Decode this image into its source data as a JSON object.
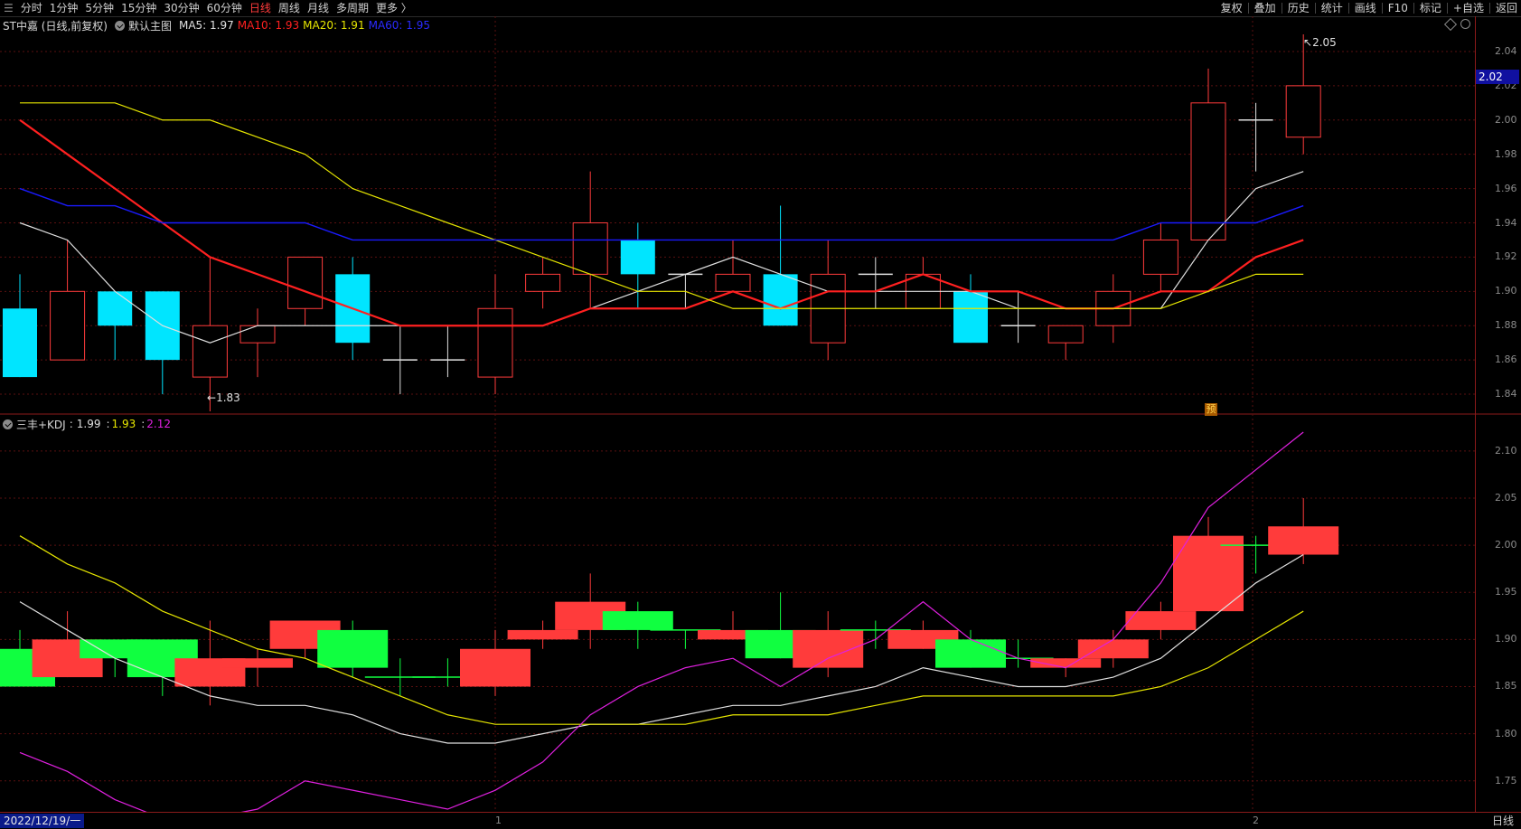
{
  "toolbar": {
    "menu_glyph": "☰",
    "left_items": [
      "分时",
      "1分钟",
      "5分钟",
      "15分钟",
      "30分钟",
      "60分钟",
      "日线",
      "周线",
      "月线",
      "多周期",
      "更多 〉"
    ],
    "active_item": "日线",
    "right_items": [
      "复权",
      "叠加",
      "历史",
      "统计",
      "画线",
      "F10",
      "标记",
      "+自选",
      "返回"
    ]
  },
  "main_panel": {
    "title": "ST中嘉 (日线,前复权)",
    "template_label": "默认主图",
    "ma5_label": "MA5: 1.97",
    "ma10_label": "MA10: 1.93",
    "ma20_label": "MA20: 1.91",
    "ma60_label": "MA60: 1.95",
    "high_marker": "2.05",
    "low_marker": "1.83",
    "current_price_tag": "2.02",
    "yu_badge": "预",
    "y_ticks": [
      "2.04",
      "2.02",
      "2.00",
      "1.98",
      "1.96",
      "1.94",
      "1.92",
      "1.90",
      "1.88",
      "1.86",
      "1.84"
    ]
  },
  "sub_panel": {
    "title": "三丰+KDJ",
    "k_value": "1.99",
    "d_value": "1.93",
    "j_value": "2.12",
    "y_ticks": [
      "2.10",
      "2.05",
      "2.00",
      "1.95",
      "1.90",
      "1.85",
      "1.80",
      "1.75"
    ]
  },
  "bottom": {
    "date": "2022/12/19/一",
    "x_marks": [
      "1",
      "2"
    ],
    "period": "日线"
  },
  "colors": {
    "up": "#ff3b3b",
    "down_main": "#00e5ff",
    "down_sub": "#10ff40",
    "ma5": "#e0e0e0",
    "ma10": "#ff2020",
    "ma20": "#e6e600",
    "ma60": "#1a1aff",
    "j_line": "#e020e0",
    "grid": "#5a1010"
  },
  "chart_data": [
    {
      "type": "candlestick",
      "title": "ST中嘉 (日线,前复权)",
      "ylim": [
        1.83,
        2.05
      ],
      "candles": [
        {
          "o": 1.89,
          "h": 1.91,
          "l": 1.85,
          "c": 1.85
        },
        {
          "o": 1.86,
          "h": 1.93,
          "l": 1.86,
          "c": 1.9
        },
        {
          "o": 1.9,
          "h": 1.9,
          "l": 1.86,
          "c": 1.88
        },
        {
          "o": 1.9,
          "h": 1.9,
          "l": 1.84,
          "c": 1.86
        },
        {
          "o": 1.85,
          "h": 1.92,
          "l": 1.83,
          "c": 1.88
        },
        {
          "o": 1.87,
          "h": 1.89,
          "l": 1.85,
          "c": 1.88
        },
        {
          "o": 1.89,
          "h": 1.92,
          "l": 1.88,
          "c": 1.92
        },
        {
          "o": 1.91,
          "h": 1.92,
          "l": 1.86,
          "c": 1.87
        },
        {
          "o": 1.86,
          "h": 1.88,
          "l": 1.84,
          "c": 1.86
        },
        {
          "o": 1.86,
          "h": 1.88,
          "l": 1.85,
          "c": 1.86
        },
        {
          "o": 1.85,
          "h": 1.91,
          "l": 1.84,
          "c": 1.89
        },
        {
          "o": 1.9,
          "h": 1.92,
          "l": 1.89,
          "c": 1.91
        },
        {
          "o": 1.91,
          "h": 1.97,
          "l": 1.89,
          "c": 1.94
        },
        {
          "o": 1.93,
          "h": 1.94,
          "l": 1.89,
          "c": 1.91
        },
        {
          "o": 1.91,
          "h": 1.91,
          "l": 1.89,
          "c": 1.91
        },
        {
          "o": 1.9,
          "h": 1.93,
          "l": 1.9,
          "c": 1.91
        },
        {
          "o": 1.91,
          "h": 1.95,
          "l": 1.88,
          "c": 1.88
        },
        {
          "o": 1.87,
          "h": 1.93,
          "l": 1.86,
          "c": 1.91
        },
        {
          "o": 1.91,
          "h": 1.92,
          "l": 1.89,
          "c": 1.91
        },
        {
          "o": 1.89,
          "h": 1.92,
          "l": 1.89,
          "c": 1.91
        },
        {
          "o": 1.9,
          "h": 1.91,
          "l": 1.87,
          "c": 1.87
        },
        {
          "o": 1.88,
          "h": 1.9,
          "l": 1.87,
          "c": 1.88
        },
        {
          "o": 1.87,
          "h": 1.88,
          "l": 1.86,
          "c": 1.88
        },
        {
          "o": 1.88,
          "h": 1.91,
          "l": 1.87,
          "c": 1.9
        },
        {
          "o": 1.91,
          "h": 1.94,
          "l": 1.9,
          "c": 1.93
        },
        {
          "o": 1.93,
          "h": 2.03,
          "l": 1.93,
          "c": 2.01
        },
        {
          "o": 2.0,
          "h": 2.01,
          "l": 1.97,
          "c": 2.0
        },
        {
          "o": 1.99,
          "h": 2.05,
          "l": 1.98,
          "c": 2.02
        }
      ],
      "series": [
        {
          "name": "MA5",
          "values": [
            1.94,
            1.93,
            1.9,
            1.88,
            1.87,
            1.88,
            1.88,
            1.88,
            1.88,
            1.88,
            1.88,
            1.88,
            1.89,
            1.9,
            1.91,
            1.92,
            1.91,
            1.9,
            1.9,
            1.9,
            1.9,
            1.89,
            1.89,
            1.89,
            1.89,
            1.93,
            1.96,
            1.97
          ]
        },
        {
          "name": "MA10",
          "values": [
            2.0,
            1.98,
            1.96,
            1.94,
            1.92,
            1.91,
            1.9,
            1.89,
            1.88,
            1.88,
            1.88,
            1.88,
            1.89,
            1.89,
            1.89,
            1.9,
            1.89,
            1.9,
            1.9,
            1.91,
            1.9,
            1.9,
            1.89,
            1.89,
            1.9,
            1.9,
            1.92,
            1.93
          ]
        },
        {
          "name": "MA20",
          "values": [
            2.01,
            2.01,
            2.01,
            2.0,
            2.0,
            1.99,
            1.98,
            1.96,
            1.95,
            1.94,
            1.93,
            1.92,
            1.91,
            1.9,
            1.9,
            1.89,
            1.89,
            1.89,
            1.89,
            1.89,
            1.89,
            1.89,
            1.89,
            1.89,
            1.89,
            1.9,
            1.91,
            1.91
          ]
        },
        {
          "name": "MA60",
          "values": [
            1.96,
            1.95,
            1.95,
            1.94,
            1.94,
            1.94,
            1.94,
            1.93,
            1.93,
            1.93,
            1.93,
            1.93,
            1.93,
            1.93,
            1.93,
            1.93,
            1.93,
            1.93,
            1.93,
            1.93,
            1.93,
            1.93,
            1.93,
            1.93,
            1.94,
            1.94,
            1.94,
            1.95
          ]
        }
      ]
    },
    {
      "type": "candlestick",
      "title": "三丰+KDJ",
      "ylim": [
        1.72,
        2.12
      ],
      "candles": [
        {
          "o": 1.89,
          "h": 1.91,
          "l": 1.85,
          "c": 1.85
        },
        {
          "o": 1.86,
          "h": 1.93,
          "l": 1.86,
          "c": 1.9
        },
        {
          "o": 1.9,
          "h": 1.9,
          "l": 1.86,
          "c": 1.88
        },
        {
          "o": 1.9,
          "h": 1.9,
          "l": 1.84,
          "c": 1.86
        },
        {
          "o": 1.85,
          "h": 1.92,
          "l": 1.83,
          "c": 1.88
        },
        {
          "o": 1.87,
          "h": 1.89,
          "l": 1.85,
          "c": 1.88
        },
        {
          "o": 1.89,
          "h": 1.92,
          "l": 1.88,
          "c": 1.92
        },
        {
          "o": 1.91,
          "h": 1.92,
          "l": 1.86,
          "c": 1.87
        },
        {
          "o": 1.86,
          "h": 1.88,
          "l": 1.84,
          "c": 1.86
        },
        {
          "o": 1.86,
          "h": 1.88,
          "l": 1.85,
          "c": 1.86
        },
        {
          "o": 1.85,
          "h": 1.91,
          "l": 1.84,
          "c": 1.89
        },
        {
          "o": 1.9,
          "h": 1.92,
          "l": 1.89,
          "c": 1.91
        },
        {
          "o": 1.91,
          "h": 1.97,
          "l": 1.89,
          "c": 1.94
        },
        {
          "o": 1.93,
          "h": 1.94,
          "l": 1.89,
          "c": 1.91
        },
        {
          "o": 1.91,
          "h": 1.91,
          "l": 1.89,
          "c": 1.91
        },
        {
          "o": 1.9,
          "h": 1.93,
          "l": 1.9,
          "c": 1.91
        },
        {
          "o": 1.91,
          "h": 1.95,
          "l": 1.88,
          "c": 1.88
        },
        {
          "o": 1.87,
          "h": 1.93,
          "l": 1.86,
          "c": 1.91
        },
        {
          "o": 1.91,
          "h": 1.92,
          "l": 1.89,
          "c": 1.91
        },
        {
          "o": 1.89,
          "h": 1.92,
          "l": 1.89,
          "c": 1.91
        },
        {
          "o": 1.9,
          "h": 1.91,
          "l": 1.87,
          "c": 1.87
        },
        {
          "o": 1.88,
          "h": 1.9,
          "l": 1.87,
          "c": 1.88
        },
        {
          "o": 1.87,
          "h": 1.88,
          "l": 1.86,
          "c": 1.88
        },
        {
          "o": 1.88,
          "h": 1.91,
          "l": 1.87,
          "c": 1.9
        },
        {
          "o": 1.91,
          "h": 1.94,
          "l": 1.9,
          "c": 1.93
        },
        {
          "o": 1.93,
          "h": 2.03,
          "l": 1.93,
          "c": 2.01
        },
        {
          "o": 2.0,
          "h": 2.01,
          "l": 1.97,
          "c": 2.0
        },
        {
          "o": 1.99,
          "h": 2.05,
          "l": 1.98,
          "c": 2.02
        }
      ],
      "series": [
        {
          "name": "K",
          "values": [
            1.94,
            1.91,
            1.88,
            1.86,
            1.84,
            1.83,
            1.83,
            1.82,
            1.8,
            1.79,
            1.79,
            1.8,
            1.81,
            1.81,
            1.82,
            1.83,
            1.83,
            1.84,
            1.85,
            1.87,
            1.86,
            1.85,
            1.85,
            1.86,
            1.88,
            1.92,
            1.96,
            1.99
          ]
        },
        {
          "name": "D",
          "values": [
            2.01,
            1.98,
            1.96,
            1.93,
            1.91,
            1.89,
            1.88,
            1.86,
            1.84,
            1.82,
            1.81,
            1.81,
            1.81,
            1.81,
            1.81,
            1.82,
            1.82,
            1.82,
            1.83,
            1.84,
            1.84,
            1.84,
            1.84,
            1.84,
            1.85,
            1.87,
            1.9,
            1.93
          ]
        },
        {
          "name": "J",
          "values": [
            1.78,
            1.76,
            1.73,
            1.71,
            1.71,
            1.72,
            1.75,
            1.74,
            1.73,
            1.72,
            1.74,
            1.77,
            1.82,
            1.85,
            1.87,
            1.88,
            1.85,
            1.88,
            1.9,
            1.94,
            1.9,
            1.88,
            1.87,
            1.9,
            1.96,
            2.04,
            2.08,
            2.12
          ]
        }
      ]
    }
  ]
}
